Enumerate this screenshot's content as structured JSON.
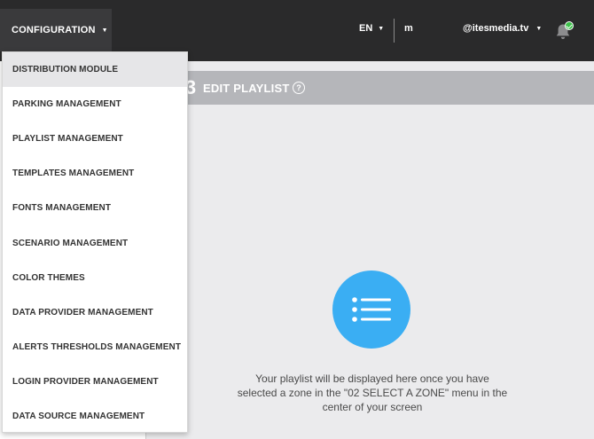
{
  "topbar": {
    "config_label": "CONFIGURATION",
    "lang_label": "EN",
    "user_initial": "m",
    "user_email": "@itesmedia.tv"
  },
  "panel": {
    "step_number": "3",
    "title": "EDIT PLAYLIST",
    "help_glyph": "?",
    "empty_message": "Your playlist will be displayed here once you have selected a zone in the \"02 SELECT A ZONE\" menu in the center of your screen"
  },
  "dropdown": {
    "items": [
      {
        "label": "DISTRIBUTION MODULE",
        "active": true
      },
      {
        "label": "PARKING MANAGEMENT"
      },
      {
        "label": "PLAYLIST MANAGEMENT"
      },
      {
        "label": "TEMPLATES MANAGEMENT"
      },
      {
        "label": "FONTS MANAGEMENT"
      },
      {
        "label": "SCENARIO MANAGEMENT"
      },
      {
        "label": "COLOR THEMES"
      },
      {
        "label": "DATA PROVIDER MANAGEMENT"
      },
      {
        "label": "ALERTS THRESHOLDS MANAGEMENT"
      },
      {
        "label": "LOGIN PROVIDER MANAGEMENT"
      },
      {
        "label": "DATA SOURCE MANAGEMENT"
      }
    ]
  },
  "icons": {
    "caret": "caret-down-icon",
    "bell": "bell-icon",
    "notification_ok": "check-badge-icon",
    "help": "help-circle-icon",
    "playlist": "list-icon"
  },
  "colors": {
    "topbar_bg": "#2a2a2b",
    "panel_header": "#b5b6ba",
    "accent_blue": "#3aaef3",
    "status_green": "#3cc24a"
  }
}
